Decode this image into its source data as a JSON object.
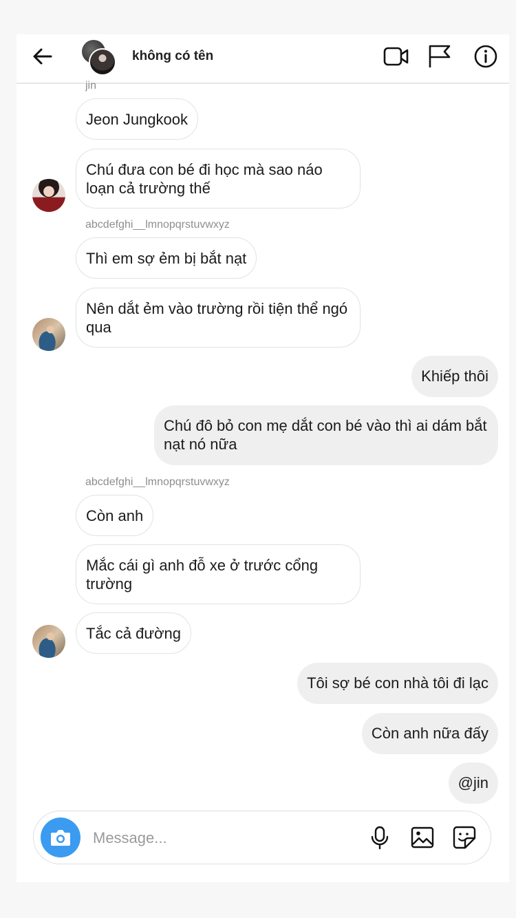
{
  "header": {
    "title": "không có tên",
    "back_icon": "arrow-left-icon",
    "icons": [
      "video-call-icon",
      "flag-icon",
      "info-icon"
    ]
  },
  "messages": [
    {
      "type": "sender",
      "text": "jin"
    },
    {
      "type": "in",
      "text": "Jeon Jungkook"
    },
    {
      "type": "in",
      "text": "Chú đưa con bé đi học mà sao náo loạn cả trường thế",
      "avatar": "jungkook"
    },
    {
      "type": "sender",
      "text": "abcdefghi__lmnopqrstuvwxyz"
    },
    {
      "type": "in",
      "text": "Thì em sợ ẻm bị bắt nạt"
    },
    {
      "type": "in",
      "text": "Nên dắt ẻm vào trường rồi tiện thể ngó qua",
      "avatar": "jin"
    },
    {
      "type": "out",
      "text": "Khiếp thôi"
    },
    {
      "type": "out",
      "text": "Chú đô bỏ con mẹ dắt con bé vào thì ai dám bắt nạt nó nữa"
    },
    {
      "type": "sender",
      "text": "abcdefghi__lmnopqrstuvwxyz"
    },
    {
      "type": "in",
      "text": "Còn anh"
    },
    {
      "type": "in",
      "text": "Mắc cái gì anh đỗ xe ở trước cổng trường"
    },
    {
      "type": "in",
      "text": "Tắc cả đường",
      "avatar": "jin"
    },
    {
      "type": "out",
      "text": "Tôi sợ bé con nhà tôi đi lạc"
    },
    {
      "type": "out",
      "text": "Còn anh nữa đấy"
    },
    {
      "type": "out",
      "text": "@jin"
    }
  ],
  "composer": {
    "placeholder": "Message...",
    "icons": [
      "camera-icon",
      "microphone-icon",
      "image-icon",
      "sticker-icon"
    ],
    "accent": "#3a9bf0"
  }
}
